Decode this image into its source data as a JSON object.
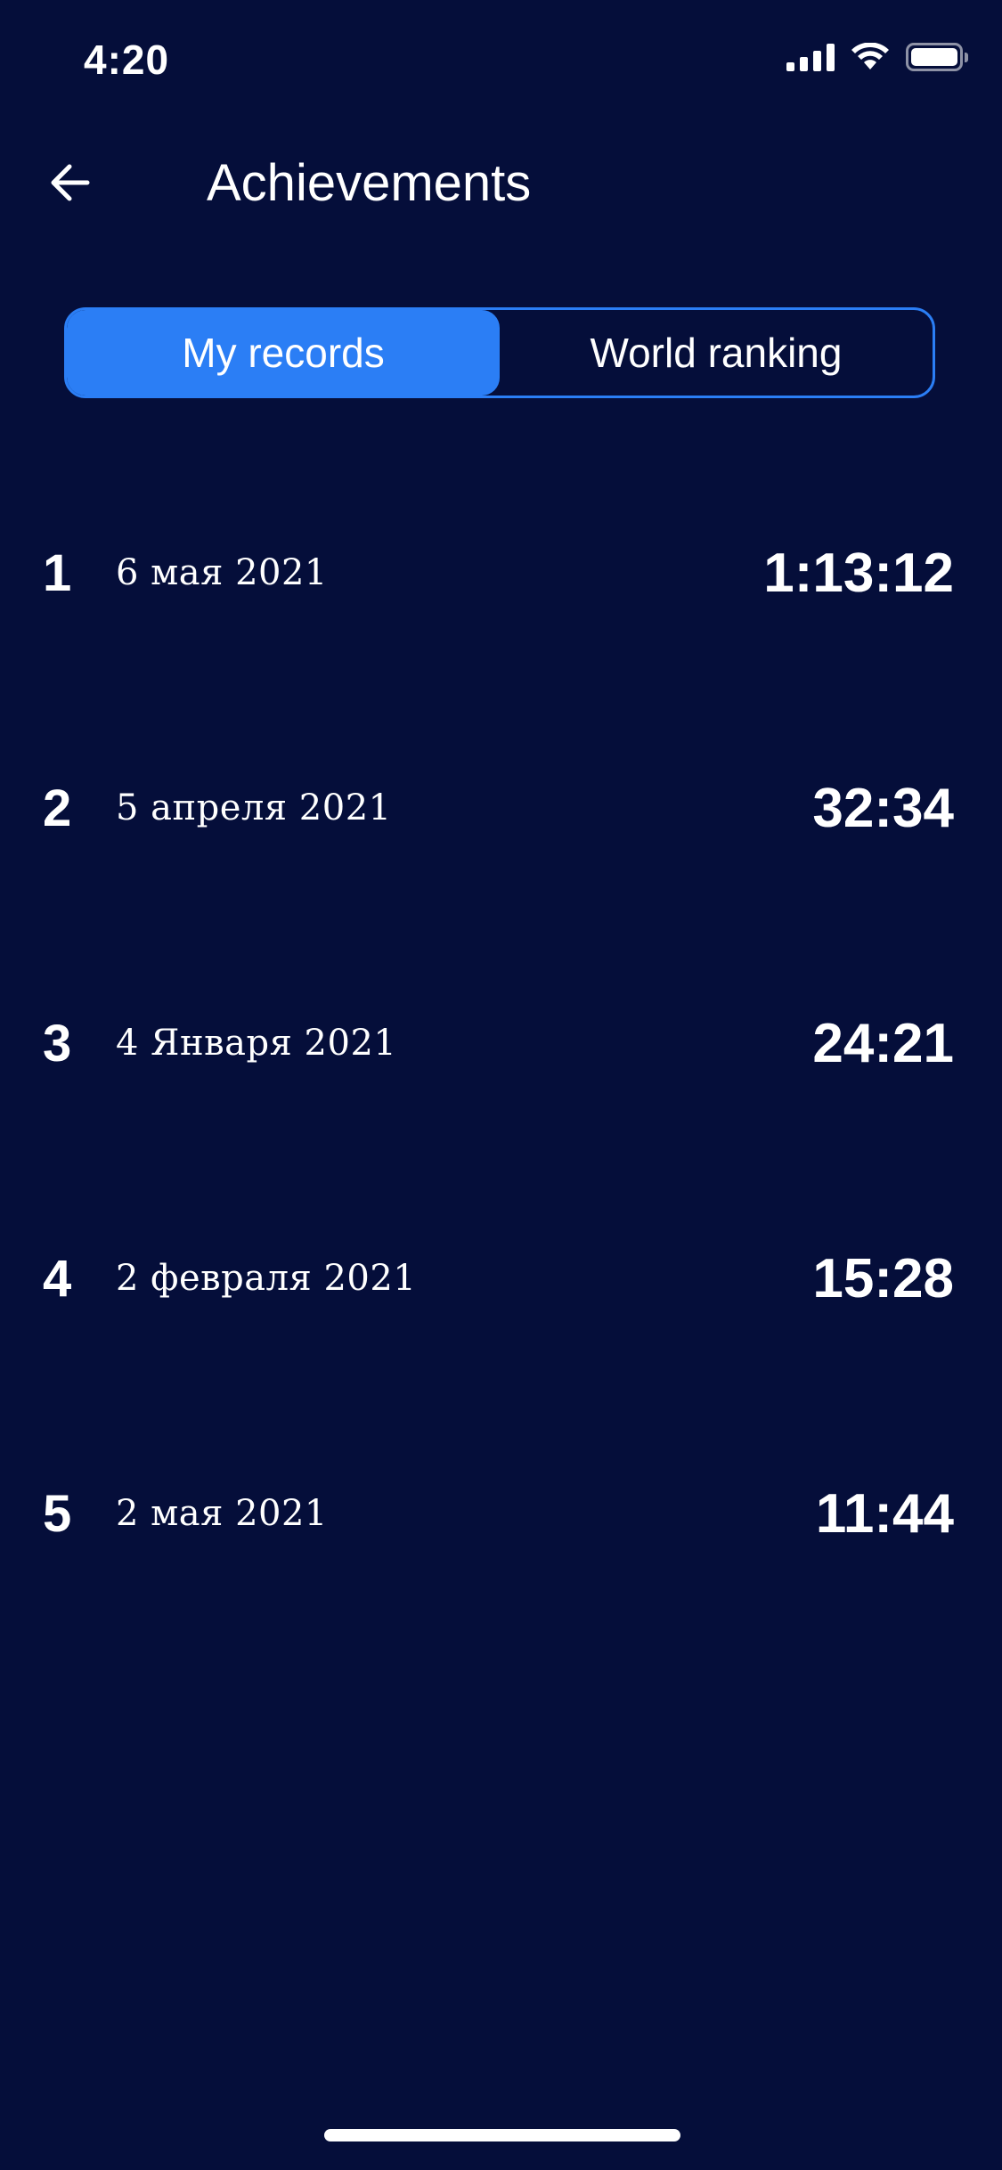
{
  "status_bar": {
    "time": "4:20",
    "icons": [
      "signal-icon",
      "wifi-icon",
      "battery-icon"
    ]
  },
  "header": {
    "title": "Achievements",
    "back_icon": "arrow-left-icon"
  },
  "tabs": [
    {
      "label": "My records",
      "active": true
    },
    {
      "label": "World ranking",
      "active": false
    }
  ],
  "records": [
    {
      "rank": "1",
      "date": "6 мая 2021",
      "time": "1:13:12"
    },
    {
      "rank": "2",
      "date": "5 апреля 2021",
      "time": "32:34"
    },
    {
      "rank": "3",
      "date": "4 Января 2021",
      "time": "24:21"
    },
    {
      "rank": "4",
      "date": "2 февраля 2021",
      "time": "15:28"
    },
    {
      "rank": "5",
      "date": "2 мая 2021",
      "time": "11:44"
    }
  ],
  "colors": {
    "background": "#050e3a",
    "accent": "#2b7ef5",
    "text": "#ffffff"
  }
}
